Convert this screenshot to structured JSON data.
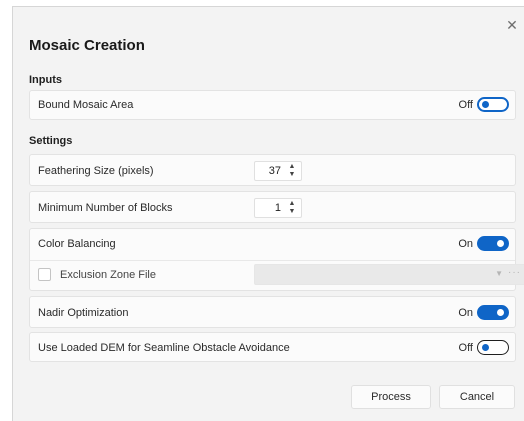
{
  "dialog": {
    "title": "Mosaic Creation",
    "close_glyph": "✕"
  },
  "inputs": {
    "section_label": "Inputs",
    "bound_mosaic_area": {
      "label": "Bound Mosaic Area",
      "state": "Off"
    }
  },
  "settings": {
    "section_label": "Settings",
    "feathering_size": {
      "label": "Feathering Size (pixels)",
      "value": "37"
    },
    "min_blocks": {
      "label": "Minimum Number of Blocks",
      "value": "1"
    },
    "color_balancing": {
      "label": "Color Balancing",
      "state": "On"
    },
    "exclusion_zone": {
      "label": "Exclusion Zone File",
      "value": ""
    },
    "nadir_optimization": {
      "label": "Nadir Optimization",
      "state": "On"
    },
    "seamline_dem": {
      "label": "Use Loaded DEM for Seamline Obstacle Avoidance",
      "state": "Off"
    }
  },
  "footer": {
    "process_label": "Process",
    "cancel_label": "Cancel"
  },
  "colors": {
    "accent": "#0f65c7",
    "background": "#f3f3f3",
    "row_background": "#fbfbfb"
  },
  "icons": {
    "close": "close-icon",
    "spinner": "spinner-arrows-icon",
    "dropdown": "chevron-down-icon",
    "browse": "ellipsis-icon"
  }
}
